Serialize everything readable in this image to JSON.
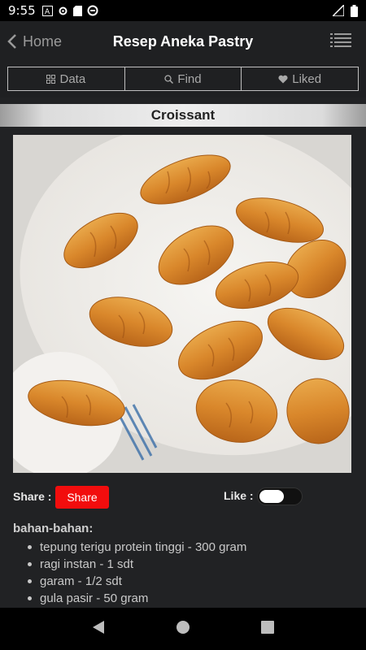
{
  "status_bar": {
    "time": "9:55"
  },
  "header": {
    "back_label": "Home",
    "title": "Resep Aneka Pastry"
  },
  "tabs": [
    {
      "label": "Data",
      "icon": "grid-icon"
    },
    {
      "label": "Find",
      "icon": "search-icon"
    },
    {
      "label": "Liked",
      "icon": "heart-icon"
    }
  ],
  "recipe": {
    "title": "Croissant",
    "share_label": "Share :",
    "share_button": "Share",
    "like_label": "Like :",
    "like_on": false,
    "ingredients_heading": "bahan-bahan:",
    "ingredients": [
      "tepung terigu protein tinggi - 300 gram",
      "ragi instan - 1 sdt",
      "garam - 1/2 sdt",
      "gula pasir - 50 gram"
    ]
  },
  "colors": {
    "accent": "#f20d0d",
    "background": "#212224",
    "header": "#1f2022"
  }
}
